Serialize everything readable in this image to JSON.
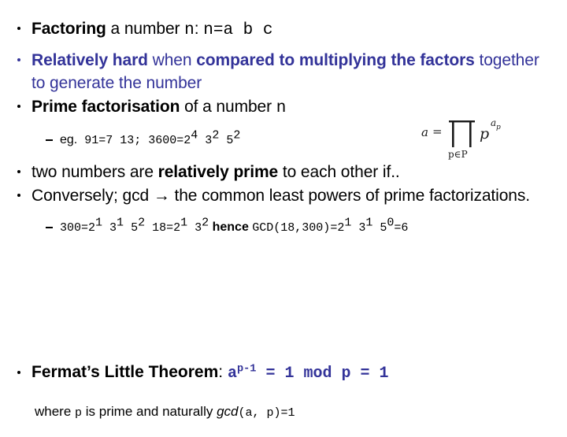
{
  "slide": {
    "background_color": "#ffffff",
    "accent_color": "#333399",
    "text_color": "#000000"
  },
  "bullets": [
    {
      "level": 1,
      "color": "black",
      "parts": [
        {
          "text": "Factoring",
          "style": "bold"
        },
        {
          "text": " a number ",
          "style": "plain"
        },
        {
          "text": "n",
          "style": "mono"
        },
        {
          "text": ": ",
          "style": "plain"
        },
        {
          "text": "n=a b c",
          "style": "mono"
        }
      ]
    },
    {
      "level": 1,
      "color": "blue",
      "parts": [
        {
          "text": "Relatively hard",
          "style": "bold"
        },
        {
          "text": " when ",
          "style": "plain"
        },
        {
          "text": "compared to multiplying the factors",
          "style": "bold"
        },
        {
          "text": " together to generate the number",
          "style": "plain"
        }
      ]
    },
    {
      "level": 1,
      "color": "black",
      "parts": [
        {
          "text": "Prime factorisation",
          "style": "bold"
        },
        {
          "text": " of a number ",
          "style": "plain"
        },
        {
          "text": "n",
          "style": "mono"
        }
      ]
    },
    {
      "level": 2,
      "color": "black",
      "parts": [
        {
          "text": "eg.",
          "style": "plain"
        },
        {
          "text": " 91=7 13; 3600=2",
          "style": "mono"
        },
        {
          "text": "4",
          "style": "mono-sup"
        },
        {
          "text": " 3",
          "style": "mono"
        },
        {
          "text": "2",
          "style": "mono-sup"
        },
        {
          "text": " 5",
          "style": "mono"
        },
        {
          "text": "2",
          "style": "mono-sup"
        }
      ]
    },
    {
      "level": 1,
      "color": "black",
      "parts": [
        {
          "text": "two numbers are ",
          "style": "plain"
        },
        {
          "text": "relatively prime",
          "style": "bold"
        },
        {
          "text": " to each other if..",
          "style": "plain"
        }
      ]
    },
    {
      "level": 1,
      "color": "black",
      "parts": [
        {
          "text": "Conversely; gcd ",
          "style": "plain"
        },
        {
          "text": "→",
          "style": "plain"
        },
        {
          "text": " the common least powers of prime factorizations.",
          "style": "plain"
        }
      ]
    },
    {
      "level": 2,
      "color": "black",
      "parts": [
        {
          "text": "300=2",
          "style": "mono"
        },
        {
          "text": "1",
          "style": "mono-sup"
        },
        {
          "text": " 3",
          "style": "mono"
        },
        {
          "text": "1",
          "style": "mono-sup"
        },
        {
          "text": " 5",
          "style": "mono"
        },
        {
          "text": "2",
          "style": "mono-sup"
        },
        {
          "text": " 18=2",
          "style": "mono"
        },
        {
          "text": "1",
          "style": "mono-sup"
        },
        {
          "text": " 3",
          "style": "mono"
        },
        {
          "text": "2",
          "style": "mono-sup"
        },
        {
          "text": " hence ",
          "style": "bold"
        },
        {
          "text": "GCD(18,300)=2",
          "style": "mono"
        },
        {
          "text": "1",
          "style": "mono-sup"
        },
        {
          "text": " 3",
          "style": "mono"
        },
        {
          "text": "1",
          "style": "mono-sup"
        },
        {
          "text": " 5",
          "style": "mono"
        },
        {
          "text": "0",
          "style": "mono-sup"
        },
        {
          "text": "=6",
          "style": "mono"
        }
      ]
    }
  ],
  "text": {
    "b1_factoring": "Factoring",
    "b1_a_number": " a number ",
    "b1_n": "n",
    "b1_colon": ": ",
    "b1_eq": "n=a b c",
    "b2_rel_hard": "Relatively hard",
    "b2_when": " when ",
    "b2_compared": "compared to multiplying the factors",
    "b2_together": " together to generate the number",
    "b3_prime_fact": "Prime factorisation",
    "b3_of_number": " of a number ",
    "b3_n": "n",
    "s1_eg": "eg.",
    "s1_body1": " 91=7 13; 3600=2",
    "s1_sup1": "4",
    "s1_body2": " 3",
    "s1_sup2": "2",
    "s1_body3": " 5",
    "s1_sup3": "2",
    "b4_two_numbers": "two numbers are ",
    "b4_rel_prime": "relatively prime",
    "b4_if": " to each other if..",
    "b5_conversely": "Conversely; gcd ",
    "b5_arrow": "→",
    "b5_rest": " the common least powers of prime factorizations.",
    "s2_p1": "300=2",
    "s2_s1": "1",
    "s2_p2": " 3",
    "s2_s2": "1",
    "s2_p3": " 5",
    "s2_s3": "2",
    "s2_p4": " 18=2",
    "s2_s4": "1",
    "s2_p5": " 3",
    "s2_s5": "2",
    "s2_hence": " hence ",
    "s2_p6": "GCD(18,300)=2",
    "s2_s6": "1",
    "s2_p7": " 3",
    "s2_s7": "1",
    "s2_p8": " 5",
    "s2_s8": "0",
    "s2_p9": "=6",
    "f_title": "Fermat’s Little Theorem",
    "f_colon": ": ",
    "f_a": "a",
    "f_exp": "p-1",
    "f_rest": " = 1 mod p = 1",
    "f_where1": "where ",
    "f_p": "p",
    "f_where2": " is prime and naturally ",
    "f_gcd": "gcd",
    "f_gcdargs": "(a, p)=1"
  },
  "formula_image": {
    "name": "prime-factorisation-formula",
    "lhs": "a",
    "equals": "=",
    "operator": "∏",
    "subscript": "p∈P",
    "base": "p",
    "exponent_base": "a",
    "exponent_sub": "p",
    "full": "a = ∏(p∈P) p^(a_p)"
  }
}
